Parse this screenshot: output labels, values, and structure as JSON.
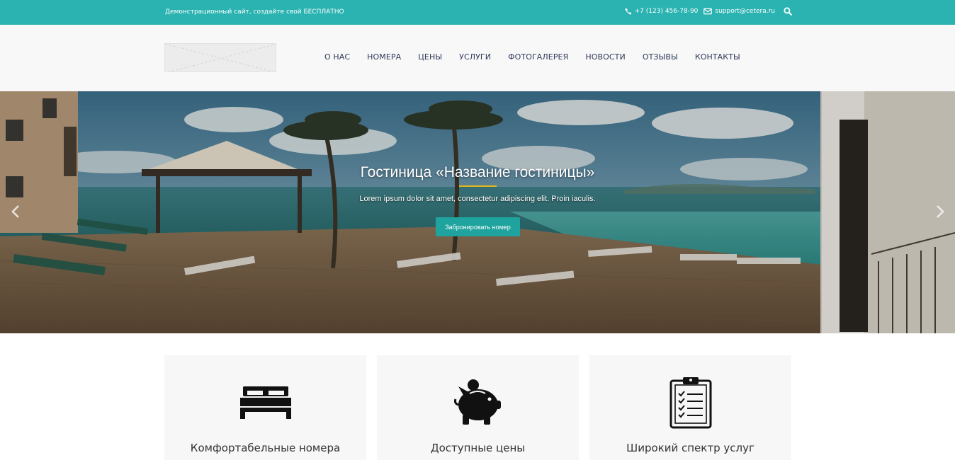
{
  "topbar": {
    "tagline": "Демонстрационный сайт, создайте свой БЕСПЛАТНО",
    "phone": "+7 (123) 456-78-90",
    "email": "support@cetera.ru"
  },
  "nav": {
    "items": [
      "О НАС",
      "НОМЕРА",
      "ЦЕНЫ",
      "УСЛУГИ",
      "ФОТОГАЛЕРЕЯ",
      "НОВОСТИ",
      "ОТЗЫВЫ",
      "КОНТАКТЫ"
    ]
  },
  "hero": {
    "title": "Гостиница «Название гостиницы»",
    "subtitle": "Lorem ipsum dolor sit amet, consectetur adipiscing elit. Proin iaculis.",
    "button": "Забронировать номер"
  },
  "features": [
    {
      "label": "Комфортабельные номера",
      "icon": "bed-icon"
    },
    {
      "label": "Доступные цены",
      "icon": "piggy-bank-icon"
    },
    {
      "label": "Широкий спектр услуг",
      "icon": "clipboard-checklist-icon"
    }
  ],
  "colors": {
    "accent": "#2bb3b1",
    "button": "#1ea39e",
    "title_underline": "#e3b619",
    "nav_text": "#2f3a5a"
  }
}
